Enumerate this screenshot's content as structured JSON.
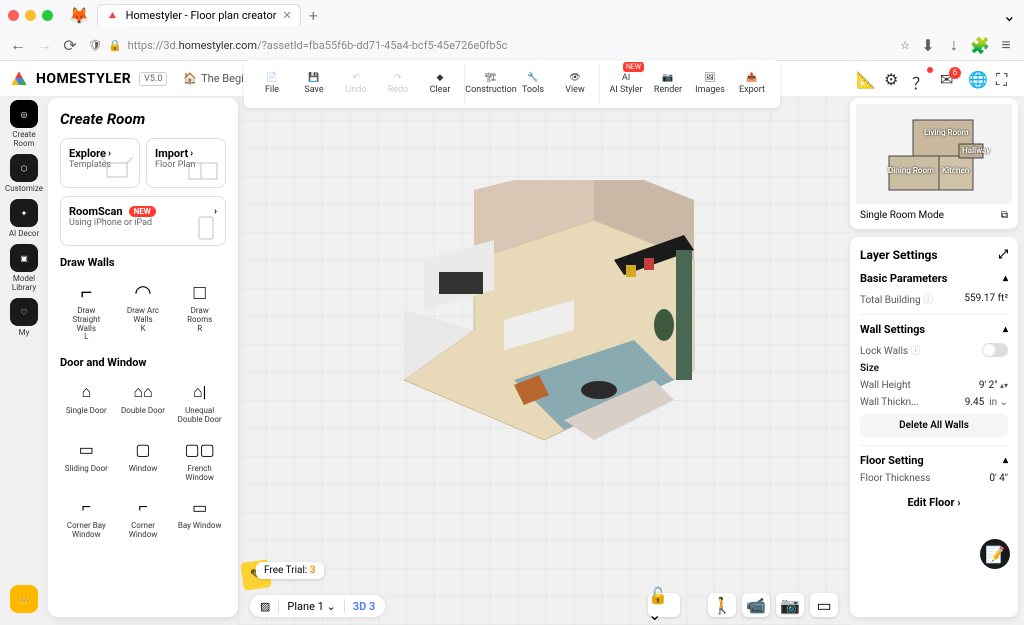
{
  "browser": {
    "tab_title": "Homestyler - Floor plan creator",
    "url_prefix": "https://3d.",
    "url_domain": "homestyler.com",
    "url_path": "/?assetId=fba55f6b-dd71-45a4-bcf5-45e726e0fb5c"
  },
  "header": {
    "brand": "HOMESTYLER",
    "version": "V5.0",
    "project": "The Beginner ..."
  },
  "toolbar": {
    "file": "File",
    "save": "Save",
    "undo": "Undo",
    "redo": "Redo",
    "clear": "Clear",
    "construction": "Construction",
    "tools": "Tools",
    "view": "View",
    "ai_styler": "AI Styler",
    "ai_badge": "NEW",
    "render": "Render",
    "images": "Images",
    "export": "Export"
  },
  "rail": {
    "create_room": "Create Room",
    "customize": "Customize",
    "ai_decor": "AI Decor",
    "model_library": "Model Library",
    "my": "My"
  },
  "panel": {
    "title": "Create Room",
    "explore": {
      "title": "Explore",
      "sub": "Templates"
    },
    "import": {
      "title": "Import",
      "sub": "Floor Plan"
    },
    "roomscan": {
      "title": "RoomScan",
      "badge": "NEW",
      "sub": "Using iPhone or iPad"
    },
    "draw_walls_head": "Draw Walls",
    "walls": [
      {
        "label": "Draw Straight Walls",
        "key": "L"
      },
      {
        "label": "Draw Arc Walls",
        "key": "K"
      },
      {
        "label": "Draw Rooms",
        "key": "R"
      }
    ],
    "door_window_head": "Door and Window",
    "door_window": [
      "Single Door",
      "Double Door",
      "Unequal Double Door",
      "Sliding Door",
      "Window",
      "French Window",
      "Corner Bay Window",
      "Corner Window",
      "Bay Window"
    ]
  },
  "canvas": {
    "free_trial_label": "Free Trial:",
    "free_trial_count": "3",
    "plane_label": "Plane 1",
    "mode_label": "3D 3"
  },
  "minimap": {
    "rooms": [
      "Living Room",
      "Hallway",
      "Dining Room",
      "Kitchen"
    ],
    "mode": "Single Room Mode"
  },
  "settings": {
    "title": "Layer Settings",
    "basic_head": "Basic Parameters",
    "total_building_label": "Total Building",
    "total_building_value": "559.17 ft²",
    "wall_head": "Wall Settings",
    "lock_walls": "Lock Walls",
    "size_head": "Size",
    "wall_height_label": "Wall Height",
    "wall_height_value": "9' 2\"",
    "wall_thickness_label": "Wall Thickn...",
    "wall_thickness_value": "9.45",
    "wall_thickness_unit": "in",
    "delete_walls": "Delete All Walls",
    "floor_head": "Floor Setting",
    "floor_thickness_label": "Floor Thickness",
    "floor_thickness_value": "0' 4\"",
    "edit_floor": "Edit Floor"
  }
}
